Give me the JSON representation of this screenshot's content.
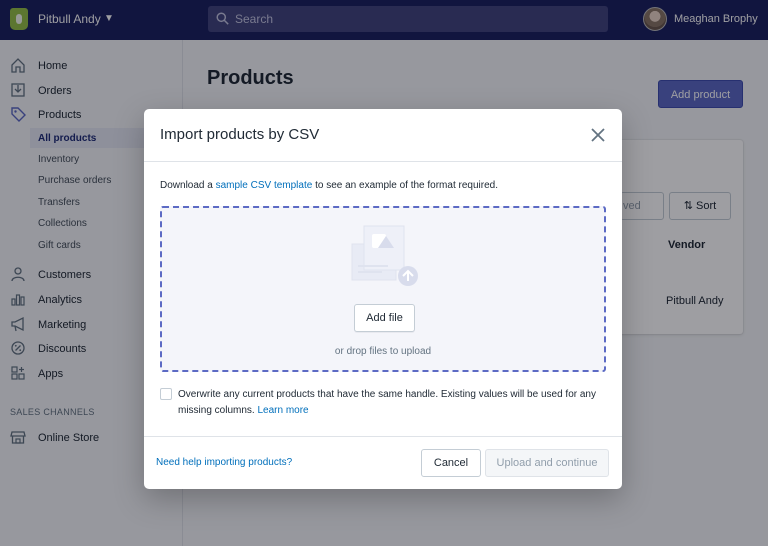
{
  "topbar": {
    "store_name": "Pitbull Andy",
    "search_placeholder": "Search",
    "user_name": "Meaghan Brophy"
  },
  "sidebar": {
    "items": [
      {
        "label": "Home",
        "icon": "home-icon"
      },
      {
        "label": "Orders",
        "icon": "orders-icon"
      },
      {
        "label": "Products",
        "icon": "tag-icon"
      },
      {
        "label": "Customers",
        "icon": "person-icon"
      },
      {
        "label": "Analytics",
        "icon": "bar-chart-icon"
      },
      {
        "label": "Marketing",
        "icon": "megaphone-icon"
      },
      {
        "label": "Discounts",
        "icon": "discount-icon"
      },
      {
        "label": "Apps",
        "icon": "apps-icon"
      }
    ],
    "sub_items": [
      "All products",
      "Inventory",
      "Purchase orders",
      "Transfers",
      "Collections",
      "Gift cards"
    ],
    "section_title": "SALES CHANNELS",
    "channel": {
      "label": "Online Store",
      "icon": "store-icon"
    }
  },
  "main": {
    "title": "Products",
    "add_button": "Add product",
    "sort_button": "Sort",
    "saved_button": "ved",
    "vendor_header": "Vendor",
    "vendor_value": "Pitbull Andy"
  },
  "modal": {
    "title": "Import products by CSV",
    "desc_before": "Download a ",
    "desc_link": "sample CSV template",
    "desc_after": " to see an example of the format required.",
    "add_file": "Add file",
    "drop_hint": "or drop files to upload",
    "overwrite_text": "Overwrite any current products that have the same handle. Existing values will be used for any missing columns. ",
    "learn_more": "Learn more",
    "overwrite_checked": false,
    "help_link": "Need help importing products?",
    "cancel": "Cancel",
    "upload": "Upload and continue"
  },
  "colors": {
    "topbar": "#1c2260",
    "primary": "#5c6ac4",
    "link": "#006fbb",
    "logo": "#95bf47"
  }
}
